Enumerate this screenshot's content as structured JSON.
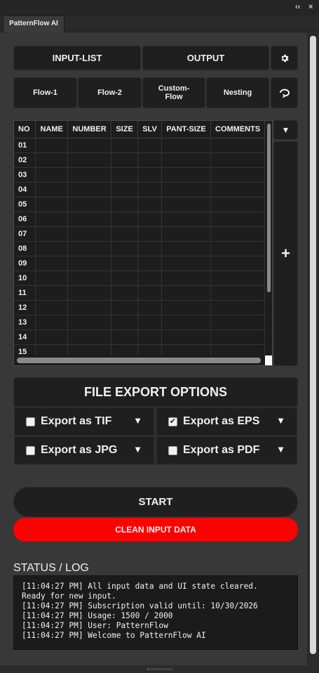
{
  "window": {
    "collapse_glyph": "‹‹",
    "close_glyph": "×",
    "tab_title": "PatternFlow AI"
  },
  "toolbar": {
    "input_list": "INPUT-LIST",
    "output": "OUTPUT",
    "settings_icon": "gear-icon"
  },
  "flows": {
    "flow1": "Flow-1",
    "flow2": "Flow-2",
    "custom_flow": "Custom-\nFlow",
    "nesting": "Nesting",
    "refresh_icon": "refresh-icon"
  },
  "table": {
    "columns": [
      "NO",
      "NAME",
      "NUMBER",
      "SIZE",
      "SLV",
      "PANT-SIZE",
      "COMMENTS"
    ],
    "rows": [
      "01",
      "02",
      "03",
      "04",
      "05",
      "06",
      "07",
      "08",
      "09",
      "10",
      "11",
      "12",
      "13",
      "14",
      "15"
    ],
    "dropdown_glyph": "▼",
    "add_glyph": "+"
  },
  "export": {
    "title": "FILE EXPORT OPTIONS",
    "options": [
      {
        "label": "Export as TIF",
        "checked": false
      },
      {
        "label": "Export as EPS",
        "checked": true
      },
      {
        "label": "Export as JPG",
        "checked": false
      },
      {
        "label": "Export as PDF",
        "checked": false
      }
    ],
    "dropdown_glyph": "▼"
  },
  "actions": {
    "start": "START",
    "clean": "CLEAN INPUT DATA",
    "clean_color": "#ff0000"
  },
  "status": {
    "title": "STATUS / LOG",
    "lines": [
      "[11:04:27 PM] All input data and UI state cleared.",
      "Ready for new input.",
      "[11:04:27 PM] Subscription valid until: 10/30/2026",
      "[11:04:27 PM] Usage: 1500 / 2000",
      "[11:04:27 PM] User: PatternFlow",
      "[11:04:27 PM] Welcome to PatternFlow AI"
    ]
  }
}
